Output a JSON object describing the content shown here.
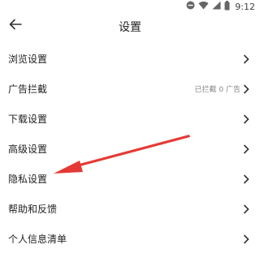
{
  "status_bar": {
    "time": "9:12",
    "icons": [
      "minus-circle-icon",
      "wifi-icon",
      "signal-icon",
      "battery-icon"
    ]
  },
  "header": {
    "title": "设置",
    "back_icon": "arrow-left-icon"
  },
  "menu": {
    "items": [
      {
        "label": "浏览设置",
        "value": ""
      },
      {
        "label": "广告拦截",
        "value": "已拦截 0 广告"
      },
      {
        "label": "下载设置",
        "value": ""
      },
      {
        "label": "高级设置",
        "value": ""
      },
      {
        "label": "隐私设置",
        "value": ""
      },
      {
        "label": "帮助和反馈",
        "value": ""
      },
      {
        "label": "个人信息清单",
        "value": ""
      }
    ]
  },
  "annotation": {
    "arrow_color": "#e53935",
    "points_to": "隐私设置"
  }
}
